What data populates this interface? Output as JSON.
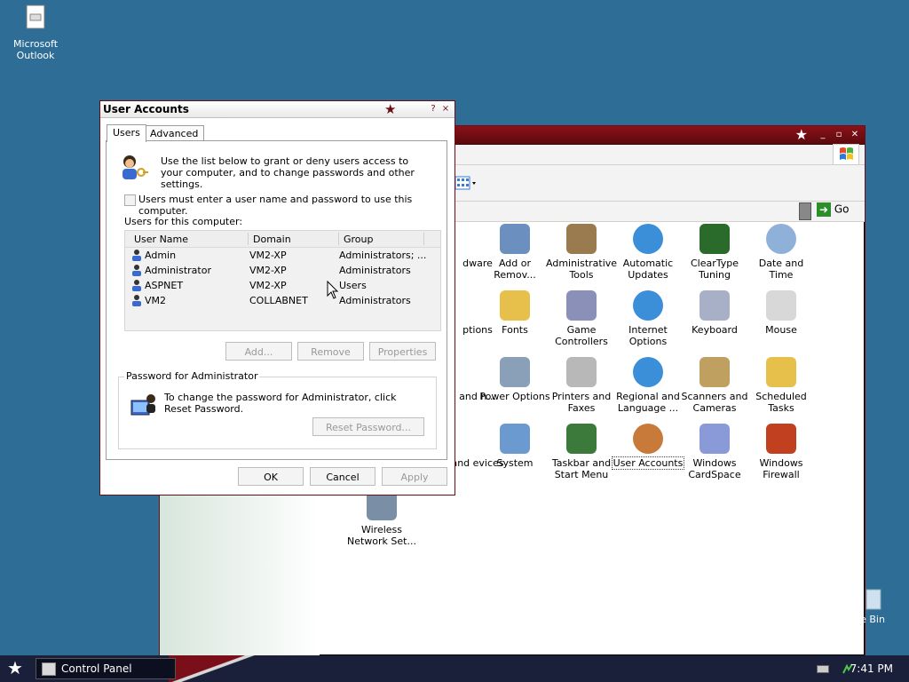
{
  "desktop": {
    "outlook_label": "Microsoft Outlook",
    "recycle_label": "cle Bin"
  },
  "control_panel": {
    "go_label": "Go",
    "items": [
      {
        "label": "dware",
        "color": "#7a8fa6"
      },
      {
        "label": "Add or Remov...",
        "color": "#6b8fbf"
      },
      {
        "label": "Administrative Tools",
        "color": "#9a7b4f"
      },
      {
        "label": "Automatic Updates",
        "color": "#3b8ed8"
      },
      {
        "label": "ClearType Tuning",
        "color": "#2a6a2a"
      },
      {
        "label": "Date and Time",
        "color": "#8fb0d8"
      },
      {
        "label": "ptions",
        "color": "#e7c04c"
      },
      {
        "label": "Fonts",
        "color": "#e7c04c"
      },
      {
        "label": "Game Controllers",
        "color": "#8a90b8"
      },
      {
        "label": "Internet Options",
        "color": "#3b8ed8"
      },
      {
        "label": "Keyboard",
        "color": "#a8b0c8"
      },
      {
        "label": "Mouse",
        "color": "#d8d8d8"
      },
      {
        "label": "and h...",
        "color": "#999999"
      },
      {
        "label": "Power Options",
        "color": "#8aa0b8"
      },
      {
        "label": "Printers and Faxes",
        "color": "#b8b8b8"
      },
      {
        "label": "Regional and Language ...",
        "color": "#3b8ed8"
      },
      {
        "label": "Scanners and Cameras",
        "color": "#c0a060"
      },
      {
        "label": "Scheduled Tasks",
        "color": "#e7c04c"
      },
      {
        "label": "and evices",
        "color": "#999999"
      },
      {
        "label": "System",
        "color": "#6a9ad0"
      },
      {
        "label": "Taskbar and Start Menu",
        "color": "#3b7a3b"
      },
      {
        "label": "User Accounts",
        "color": "#c87a3a"
      },
      {
        "label": "Windows CardSpace",
        "color": "#8a9ad8"
      },
      {
        "label": "Windows Firewall",
        "color": "#c04020"
      },
      {
        "label": "Wireless Network Set...",
        "color": "#7a8fa6"
      }
    ]
  },
  "dialog": {
    "title": "User Accounts",
    "help_btn": "?",
    "close_btn": "×",
    "tabs": [
      "Users",
      "Advanced"
    ],
    "intro": "Use the list below to grant or deny users access to your computer, and to change passwords and other settings.",
    "checkbox_label": "Users must enter a user name and password to use this computer.",
    "users_heading": "Users for this computer:",
    "columns": [
      "User Name",
      "Domain",
      "Group"
    ],
    "users": [
      {
        "name": "Admin",
        "domain": "VM2-XP",
        "group": "Administrators; ..."
      },
      {
        "name": "Administrator",
        "domain": "VM2-XP",
        "group": "Administrators"
      },
      {
        "name": "ASPNET",
        "domain": "VM2-XP",
        "group": "Users"
      },
      {
        "name": "VM2",
        "domain": "COLLABNET",
        "group": "Administrators"
      }
    ],
    "btn_add": "Add...",
    "btn_remove": "Remove",
    "btn_properties": "Properties",
    "password_group": "Password for Administrator",
    "password_text": "To change the password for Administrator, click Reset Password.",
    "btn_reset": "Reset Password...",
    "btn_ok": "OK",
    "btn_cancel": "Cancel",
    "btn_apply": "Apply"
  },
  "taskbar": {
    "task_label": "Control Panel",
    "clock": "7:41 PM"
  }
}
